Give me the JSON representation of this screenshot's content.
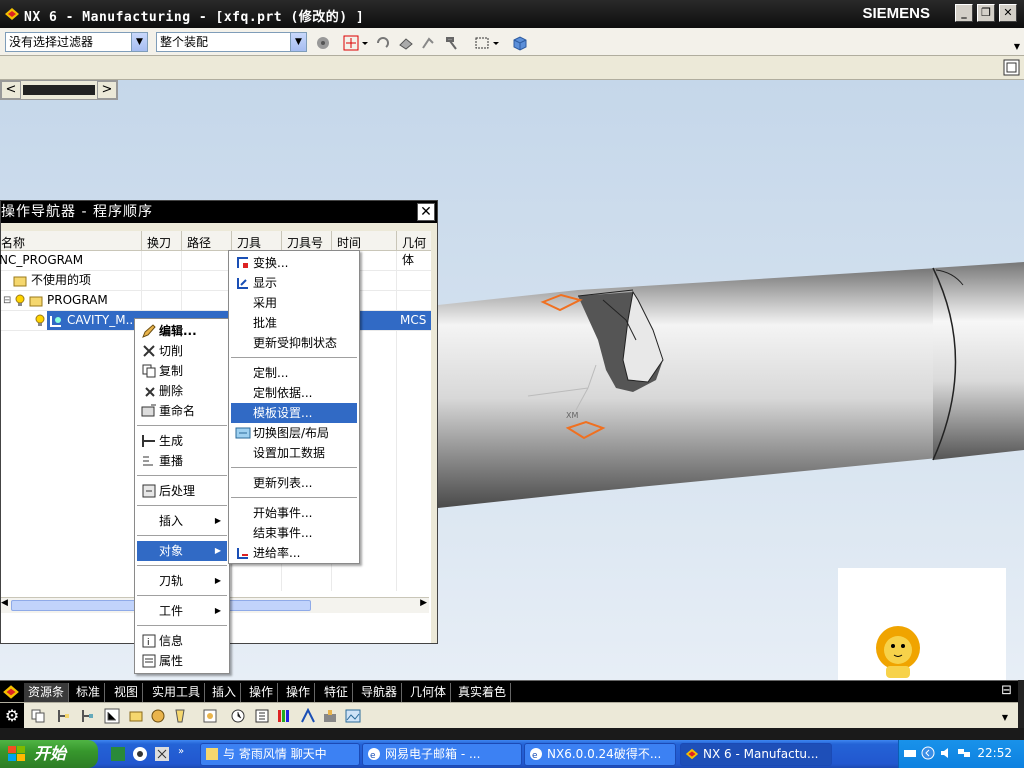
{
  "window": {
    "title": "NX 6 - Manufacturing - [xfq.prt (修改的) ]",
    "brand": "SIEMENS",
    "minimize": "_",
    "maximize": "❐",
    "close": "✕"
  },
  "toolbar": {
    "filter_combo": "没有选择过滤器",
    "assembly_combo": "整个装配"
  },
  "navigator": {
    "title": "操作导航器 - 程序顺序",
    "close": "✕",
    "columns": [
      "名称",
      "换刀",
      "路径",
      "刀具",
      "刀具号",
      "时间",
      "几何体"
    ],
    "rows": [
      {
        "name": "NC_PROGRAM"
      },
      {
        "name": "不使用的项"
      },
      {
        "name": "PROGRAM"
      },
      {
        "name": "CAVITY_M...",
        "geometry": "MCS"
      }
    ]
  },
  "context_menu": {
    "items": [
      {
        "label": "编辑...",
        "bold": true
      },
      {
        "label": "切削"
      },
      {
        "label": "复制"
      },
      {
        "label": "删除"
      },
      {
        "label": "重命名"
      },
      {
        "label": "生成"
      },
      {
        "label": "重播"
      },
      {
        "label": "后处理"
      },
      {
        "label": "插入"
      },
      {
        "label": "对象"
      },
      {
        "label": "刀轨"
      },
      {
        "label": "工件"
      },
      {
        "label": "信息"
      },
      {
        "label": "属性"
      }
    ]
  },
  "submenu": {
    "items": [
      {
        "label": "变换..."
      },
      {
        "label": "显示"
      },
      {
        "label": "采用"
      },
      {
        "label": "批准"
      },
      {
        "label": "更新受抑制状态"
      },
      {
        "label": "定制..."
      },
      {
        "label": "定制依据..."
      },
      {
        "label": "模板设置..."
      },
      {
        "label": "切换图层/布局"
      },
      {
        "label": "设置加工数据"
      },
      {
        "label": "更新列表..."
      },
      {
        "label": "开始事件..."
      },
      {
        "label": "结束事件..."
      },
      {
        "label": "进给率..."
      }
    ]
  },
  "resource_tabs": [
    "资源条",
    "标准",
    "视图",
    "实用工具",
    "插入",
    "操作",
    "操作",
    "特征",
    "导航器",
    "几何体",
    "真实着色"
  ],
  "taskbar": {
    "start": "开始",
    "tasks": [
      "与 寄雨风情 聊天中",
      "网易电子邮箱 - ...",
      "NX6.0.0.24破得不...",
      "NX 6 - Manufactu..."
    ],
    "clock": "22:52"
  },
  "colors": {
    "selection": "#316ac5",
    "title_bar": "#000000",
    "xp_taskbar": "#2257cf",
    "start_button": "#37972d"
  }
}
